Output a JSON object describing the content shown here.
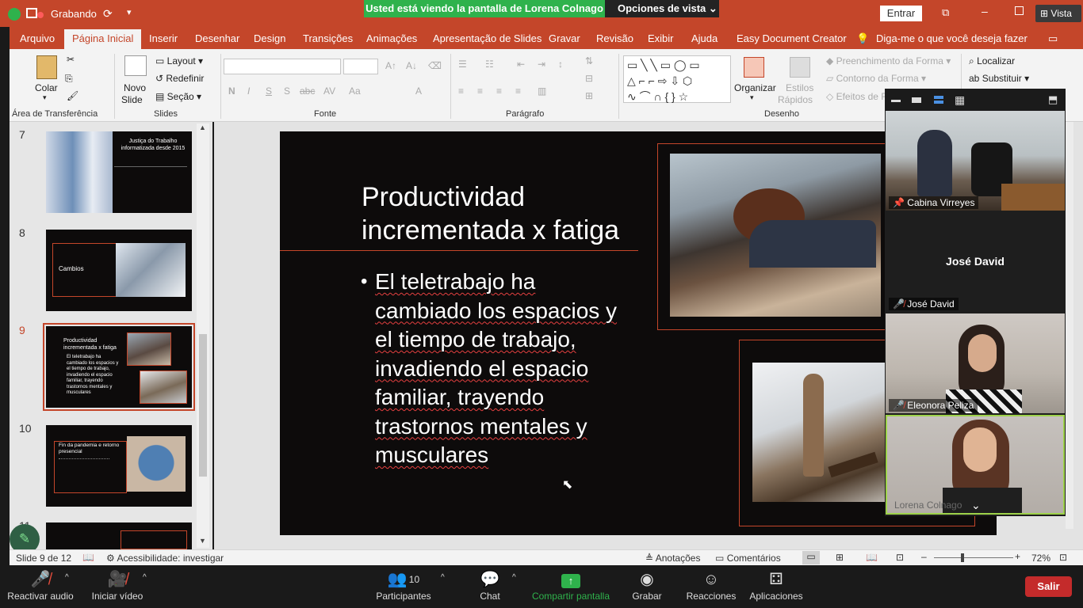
{
  "titlebar": {
    "recording": "Grabando",
    "enter": "Entrar",
    "view": "Vista",
    "banner_text": "Usted está viendo la pantalla de Lorena Colnago",
    "view_options": "Opciones de vista"
  },
  "tabs": [
    "Arquivo",
    "Página Inicial",
    "Inserir",
    "Desenhar",
    "Design",
    "Transições",
    "Animações",
    "Apresentação de Slides",
    "Gravar",
    "Revisão",
    "Exibir",
    "Ajuda",
    "Easy Document Creator"
  ],
  "tell_me": "Diga-me o que você deseja fazer",
  "ribbon": {
    "paste": "Colar",
    "clipboard_group": "Área de Transferência",
    "new_slide_1": "Novo",
    "new_slide_2": "Slide",
    "layout": "Layout",
    "reset": "Redefinir",
    "section": "Seção",
    "slides_group": "Slides",
    "font_group": "Fonte",
    "paragraph_group": "Parágrafo",
    "organize": "Organizar",
    "quick_styles_1": "Estilos",
    "quick_styles_2": "Rápidos",
    "shape_fill": "Preenchimento da Forma",
    "shape_outline": "Contorno da Forma",
    "shape_effects": "Efeitos de F",
    "drawing_group": "Desenho",
    "find": "Localizar",
    "replace": "Substituir"
  },
  "thumbnails": [
    {
      "num": "7",
      "title": "Justiça do Trabalho informatizada desde 2015"
    },
    {
      "num": "8",
      "title": "Cambios"
    },
    {
      "num": "9",
      "title": "Productividad incrementada x fatiga",
      "body": "El teletrabajo ha cambiado los espacios y el tiempo de trabajo, invadiendo el espacio familiar, trayendo trastornos mentales y musculares"
    },
    {
      "num": "10",
      "title": "Fin da pandemia e retorno presencial"
    },
    {
      "num": "11"
    }
  ],
  "slide": {
    "title": "Productividad incrementada x fatiga",
    "body": "El teletrabajo ha cambiado los espacios y el tiempo de trabajo, invadiendo el espacio familiar, trayendo trastornos mentales y musculares"
  },
  "statusbar": {
    "slide_of": "Slide 9 de 12",
    "accessibility": "Acessibilidade: investigar",
    "notes": "Anotações",
    "comments": "Comentários",
    "zoom": "72%"
  },
  "participants": [
    {
      "name": "Cabina Virreyes"
    },
    {
      "name": "José David",
      "big_name": "José David"
    },
    {
      "name": "Eleonora Peliza"
    },
    {
      "name": "Lorena Colnago"
    }
  ],
  "zoom_toolbar": {
    "audio": "Reactivar audio",
    "video": "Iniciar vídeo",
    "participants": "Participantes",
    "participants_count": "10",
    "chat": "Chat",
    "share": "Compartir pantalla",
    "record": "Grabar",
    "reactions": "Reacciones",
    "apps": "Aplicaciones",
    "leave": "Salir"
  },
  "colors": {
    "accent": "#c4462a",
    "share_green": "#2fb24c",
    "leave_red": "#c42b2b"
  }
}
